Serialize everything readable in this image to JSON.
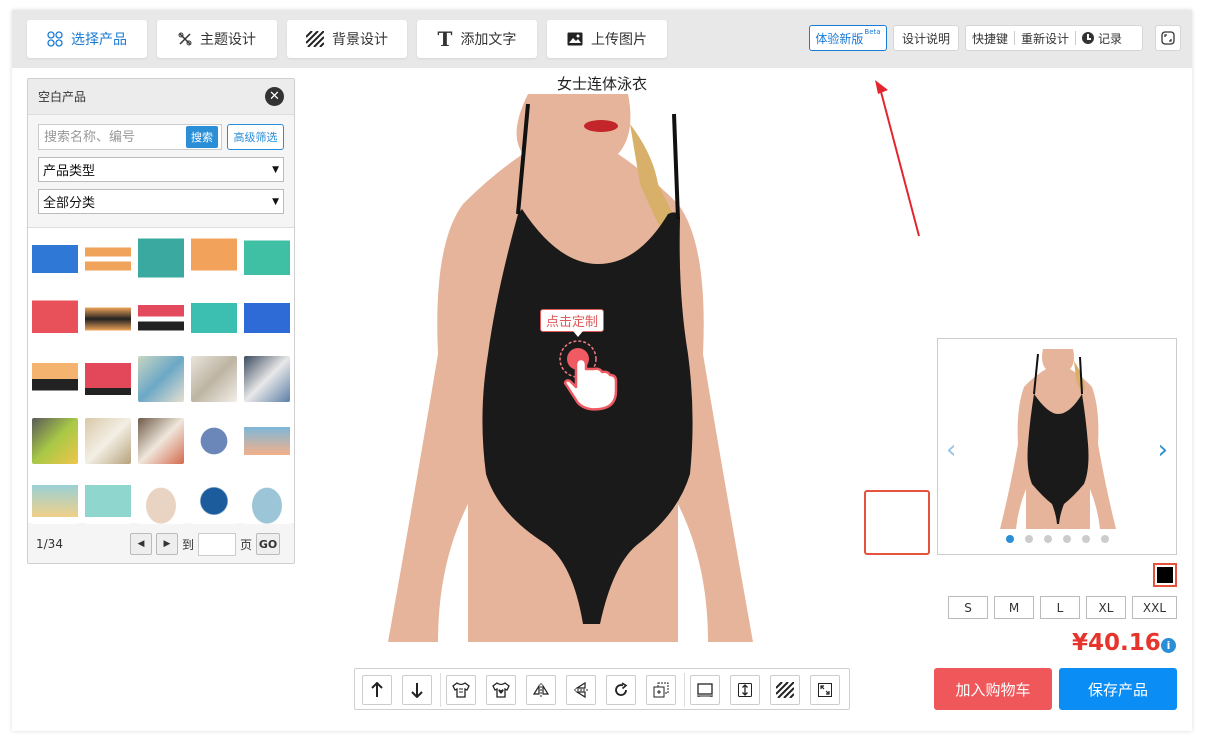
{
  "tabs": [
    {
      "label": "选择产品",
      "icon": "grid-icon",
      "active": true
    },
    {
      "label": "主题设计",
      "icon": "theme-icon",
      "active": false
    },
    {
      "label": "背景设计",
      "icon": "stripes-icon",
      "active": false
    },
    {
      "label": "添加文字",
      "icon": "text-icon",
      "active": false
    },
    {
      "label": "上传图片",
      "icon": "image-icon",
      "active": false
    }
  ],
  "topright": {
    "beta_label": "体验新版",
    "beta_tag": "Beta",
    "design_help": "设计说明",
    "shortcuts": "快捷键",
    "redesign": "重新设计",
    "history": "记录"
  },
  "panel": {
    "title": "空白产品",
    "search_placeholder": "搜索名称、编号",
    "search_button": "搜索",
    "advanced_filter": "高级筛选",
    "product_type": "产品类型",
    "all_categories": "全部分类",
    "page_indicator": "1/34",
    "to_label": "到",
    "page_label": "页",
    "go_label": "GO"
  },
  "product": {
    "title": "女士连体泳衣",
    "customize_label": "点击定制",
    "sizes": [
      "S",
      "M",
      "L",
      "XL",
      "XXL"
    ],
    "color": "#000000",
    "price": "¥40.16",
    "carousel_total": 6,
    "carousel_active": 1
  },
  "actions": {
    "add_to_cart": "加入购物车",
    "save_product": "保存产品"
  },
  "colors": {
    "accent": "#1a7bd6",
    "price": "#e5352d",
    "cart": "#f0575a",
    "save": "#0a8ef6"
  }
}
